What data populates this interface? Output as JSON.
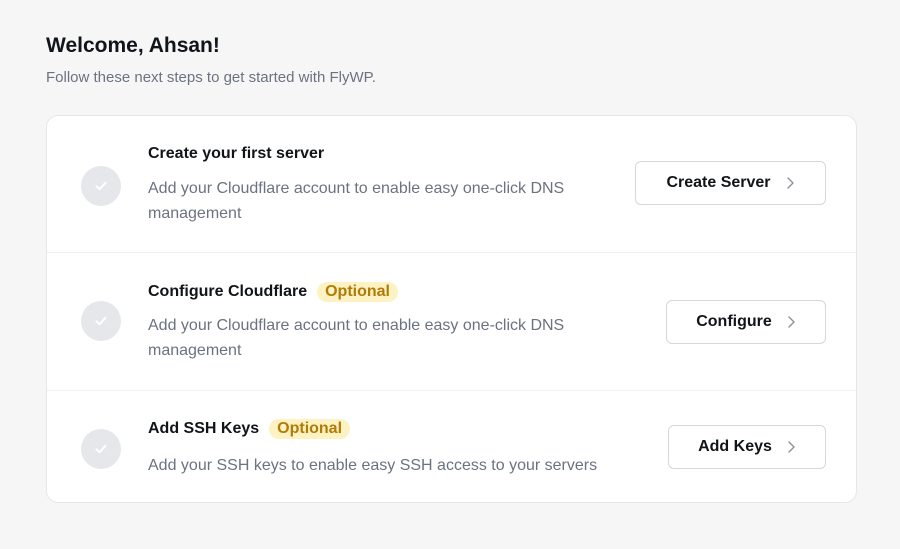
{
  "header": {
    "title": "Welcome, Ahsan!",
    "subtitle": "Follow these next steps to get started with FlyWP."
  },
  "steps": [
    {
      "title": "Create your first server",
      "badge": "",
      "description": "Add your Cloudflare account to enable easy one-click DNS management",
      "button_label": "Create Server"
    },
    {
      "title": "Configure Cloudflare",
      "badge": "Optional",
      "description": "Add your Cloudflare account to enable easy one-click DNS management",
      "button_label": "Configure"
    },
    {
      "title": "Add SSH Keys",
      "badge": "Optional",
      "description": "Add your SSH keys to enable easy SSH access to your servers",
      "button_label": "Add Keys"
    }
  ],
  "icons": {
    "step_status": "check-icon",
    "button_arrow": "chevron-right-icon"
  },
  "colors": {
    "background": "#f6f6f7",
    "card": "#ffffff",
    "badge_bg": "#fdf2c2",
    "badge_text": "#b27b07",
    "check_circle": "#e6e7eb"
  }
}
